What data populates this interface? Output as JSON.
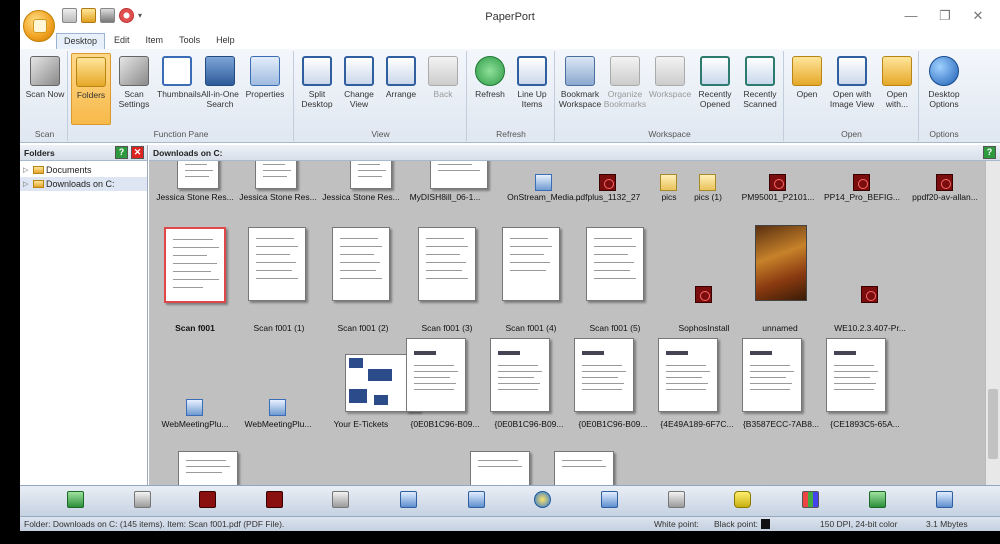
{
  "app": {
    "title": "PaperPort"
  },
  "window_controls": {
    "minimize": "—",
    "maximize": "❐",
    "close": "✕"
  },
  "menu": {
    "items": [
      "Desktop",
      "Edit",
      "Item",
      "Tools",
      "Help"
    ]
  },
  "ribbon": {
    "groups": [
      {
        "label": "Scan",
        "buttons": [
          {
            "label": "Scan Now",
            "icon": "scanner-icon"
          }
        ]
      },
      {
        "label": "Function Pane",
        "buttons": [
          {
            "label": "Folders",
            "icon": "folder-icon"
          },
          {
            "label": "Scan Settings",
            "icon": "scan-settings-icon"
          },
          {
            "label": "Thumbnails",
            "icon": "thumbnails-icon"
          },
          {
            "label": "All-in-One Search",
            "icon": "binoculars-icon"
          },
          {
            "label": "Properties",
            "icon": "properties-icon"
          }
        ]
      },
      {
        "label": "View",
        "buttons": [
          {
            "label": "Split Desktop",
            "icon": "split-desktop-icon"
          },
          {
            "label": "Change View",
            "icon": "change-view-icon"
          },
          {
            "label": "Arrange",
            "icon": "arrange-icon"
          },
          {
            "label": "Back",
            "icon": "back-icon"
          }
        ]
      },
      {
        "label": "Refresh",
        "buttons": [
          {
            "label": "Refresh",
            "icon": "refresh-icon"
          },
          {
            "label": "Line Up Items",
            "icon": "line-up-icon"
          }
        ]
      },
      {
        "label": "Workspace",
        "buttons": [
          {
            "label": "Bookmark Workspace",
            "icon": "bookmark-workspace-icon"
          },
          {
            "label": "Organize Bookmarks",
            "icon": "organize-bookmarks-icon"
          },
          {
            "label": "Workspace",
            "icon": "workspace-icon"
          },
          {
            "label": "Recently Opened",
            "icon": "recently-opened-icon"
          },
          {
            "label": "Recently Scanned",
            "icon": "recently-scanned-icon"
          }
        ]
      },
      {
        "label": "Open",
        "buttons": [
          {
            "label": "Open",
            "icon": "open-folder-icon"
          },
          {
            "label": "Open with Image View",
            "icon": "image-view-icon"
          },
          {
            "label": "Open with...",
            "icon": "open-with-icon"
          }
        ]
      },
      {
        "label": "Options",
        "buttons": [
          {
            "label": "Desktop Options",
            "icon": "desktop-options-icon"
          }
        ]
      }
    ]
  },
  "folders_pane": {
    "title": "Folders",
    "items": [
      "Documents",
      "Downloads on C:"
    ]
  },
  "content": {
    "title": "Downloads on C:",
    "items": [
      "Jessica Stone Res...",
      "Jessica Stone Res...",
      "Jessica Stone Res...",
      "MyDISH8ill_06-1...",
      "OnStream_Media...",
      "pdfplus_1132_27",
      "pics",
      "pics (1)",
      "PM95001_P2101...",
      "PP14_Pro_BEFIG...",
      "ppdf20-av-allan...",
      "Scan f001",
      "Scan f001 (1)",
      "Scan f001 (2)",
      "Scan f001 (3)",
      "Scan f001 (4)",
      "Scan f001 (5)",
      "SophosInstall",
      "unnamed",
      "WE10.2.3.407-Pr...",
      "WebMeetingPlu...",
      "WebMeetingPlu...",
      "Your E-Tickets",
      "{0E0B1C96-B09...",
      "{0E0B1C96-B09...",
      "{0E0B1C96-B09...",
      "{4E49A189-6F7C...",
      "{B3587ECC-7AB8...",
      "{CE1893C5-65A..."
    ]
  },
  "statusbar": {
    "info": "Folder: Downloads on C: (145 items). Item: Scan f001.pdf (PDF File).",
    "white_point": "White point:",
    "black_point": "Black point:",
    "resolution": "150 DPI, 24-bit color",
    "size": "3.1 Mbytes"
  }
}
